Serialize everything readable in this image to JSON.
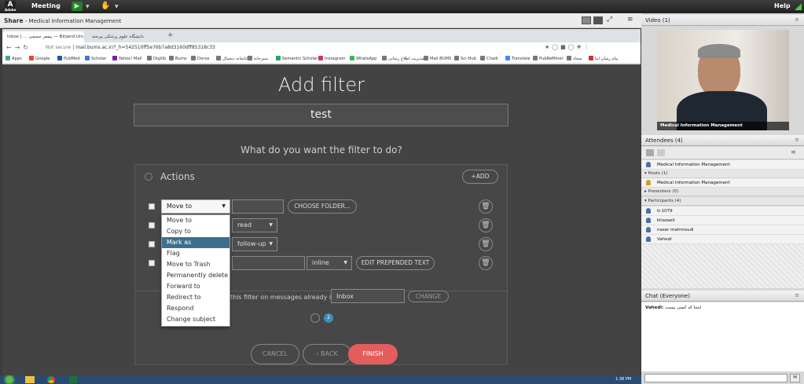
{
  "topbar": {
    "meeting": "Meeting",
    "help": "Help"
  },
  "share": {
    "title": "Share",
    "sep": " - ",
    "subtitle": "Medical Information Management"
  },
  "browser": {
    "tabs": [
      "Inbox | … بیمقر جسمی — Birjand Uni…",
      "دانشگاه علوم پزشکی بیرجند"
    ],
    "url_prefix": "Not secure",
    "url": "mail.bums.ac.ir/?_h=542510ff5e76b7a8d3160dff85318c33",
    "bookmarks": [
      "Apps",
      "Google",
      "PubMed",
      "Scholar",
      "Yahoo! Mail",
      "Digilib",
      "Bums",
      "Dorsa",
      "کتابخانه دیجیتال",
      "سیرجانه",
      "Semantic Scholar",
      "Instagram",
      "WhatsApp",
      "مدیریت اطلاع رسانی",
      "Mail BUMS",
      "Sci-Hub",
      "Chadi",
      "Translate",
      "PubReMiner",
      "سجاد",
      "پیام رسان ایتا"
    ]
  },
  "filter": {
    "title": "Add filter",
    "name": "test",
    "question": "What do you want the filter to do?",
    "actions_label": "Actions",
    "add_label": "+ADD",
    "action_select": "Move to",
    "choose_folder": "CHOOSE FOLDER...",
    "read_select": "read",
    "followup_select": "follow-up",
    "inline_select": "inline",
    "edit_prepended": "EDIT PREPENDED TEXT",
    "apply_text": "this filter on messages already in:",
    "apply_folder": "Inbox",
    "change_label": "CHANGE",
    "page_label": "2",
    "dropdown": [
      "Move to",
      "Copy to",
      "Mark as",
      "Flag",
      "Move to Trash",
      "Permanently delete",
      "Forward to",
      "Redirect to",
      "Respond",
      "Change subject"
    ],
    "highlighted": "Mark as",
    "cancel": "CANCEL",
    "back": "‹ BACK",
    "finish": "FINISH"
  },
  "taskbar": {
    "time": "1:38 PM"
  },
  "video": {
    "title": "Video",
    "count": "(1)",
    "label": "Medical Information Management"
  },
  "attendees": {
    "title": "Attendees",
    "count": "(4)",
    "me": "Medical Information Management",
    "hosts": "Hosts (1)",
    "host": "Medical Information Management",
    "presenters": "Presenters (0)",
    "participants": "Participants (4)",
    "people": [
      "it-1079",
      "khazaeli",
      "naser mahmoudi",
      "Vahedi"
    ]
  },
  "chat": {
    "title": "Chat",
    "scope": "(Everyone)",
    "sender": "Vahedi:",
    "message": "اینجا که کسی نیست"
  }
}
